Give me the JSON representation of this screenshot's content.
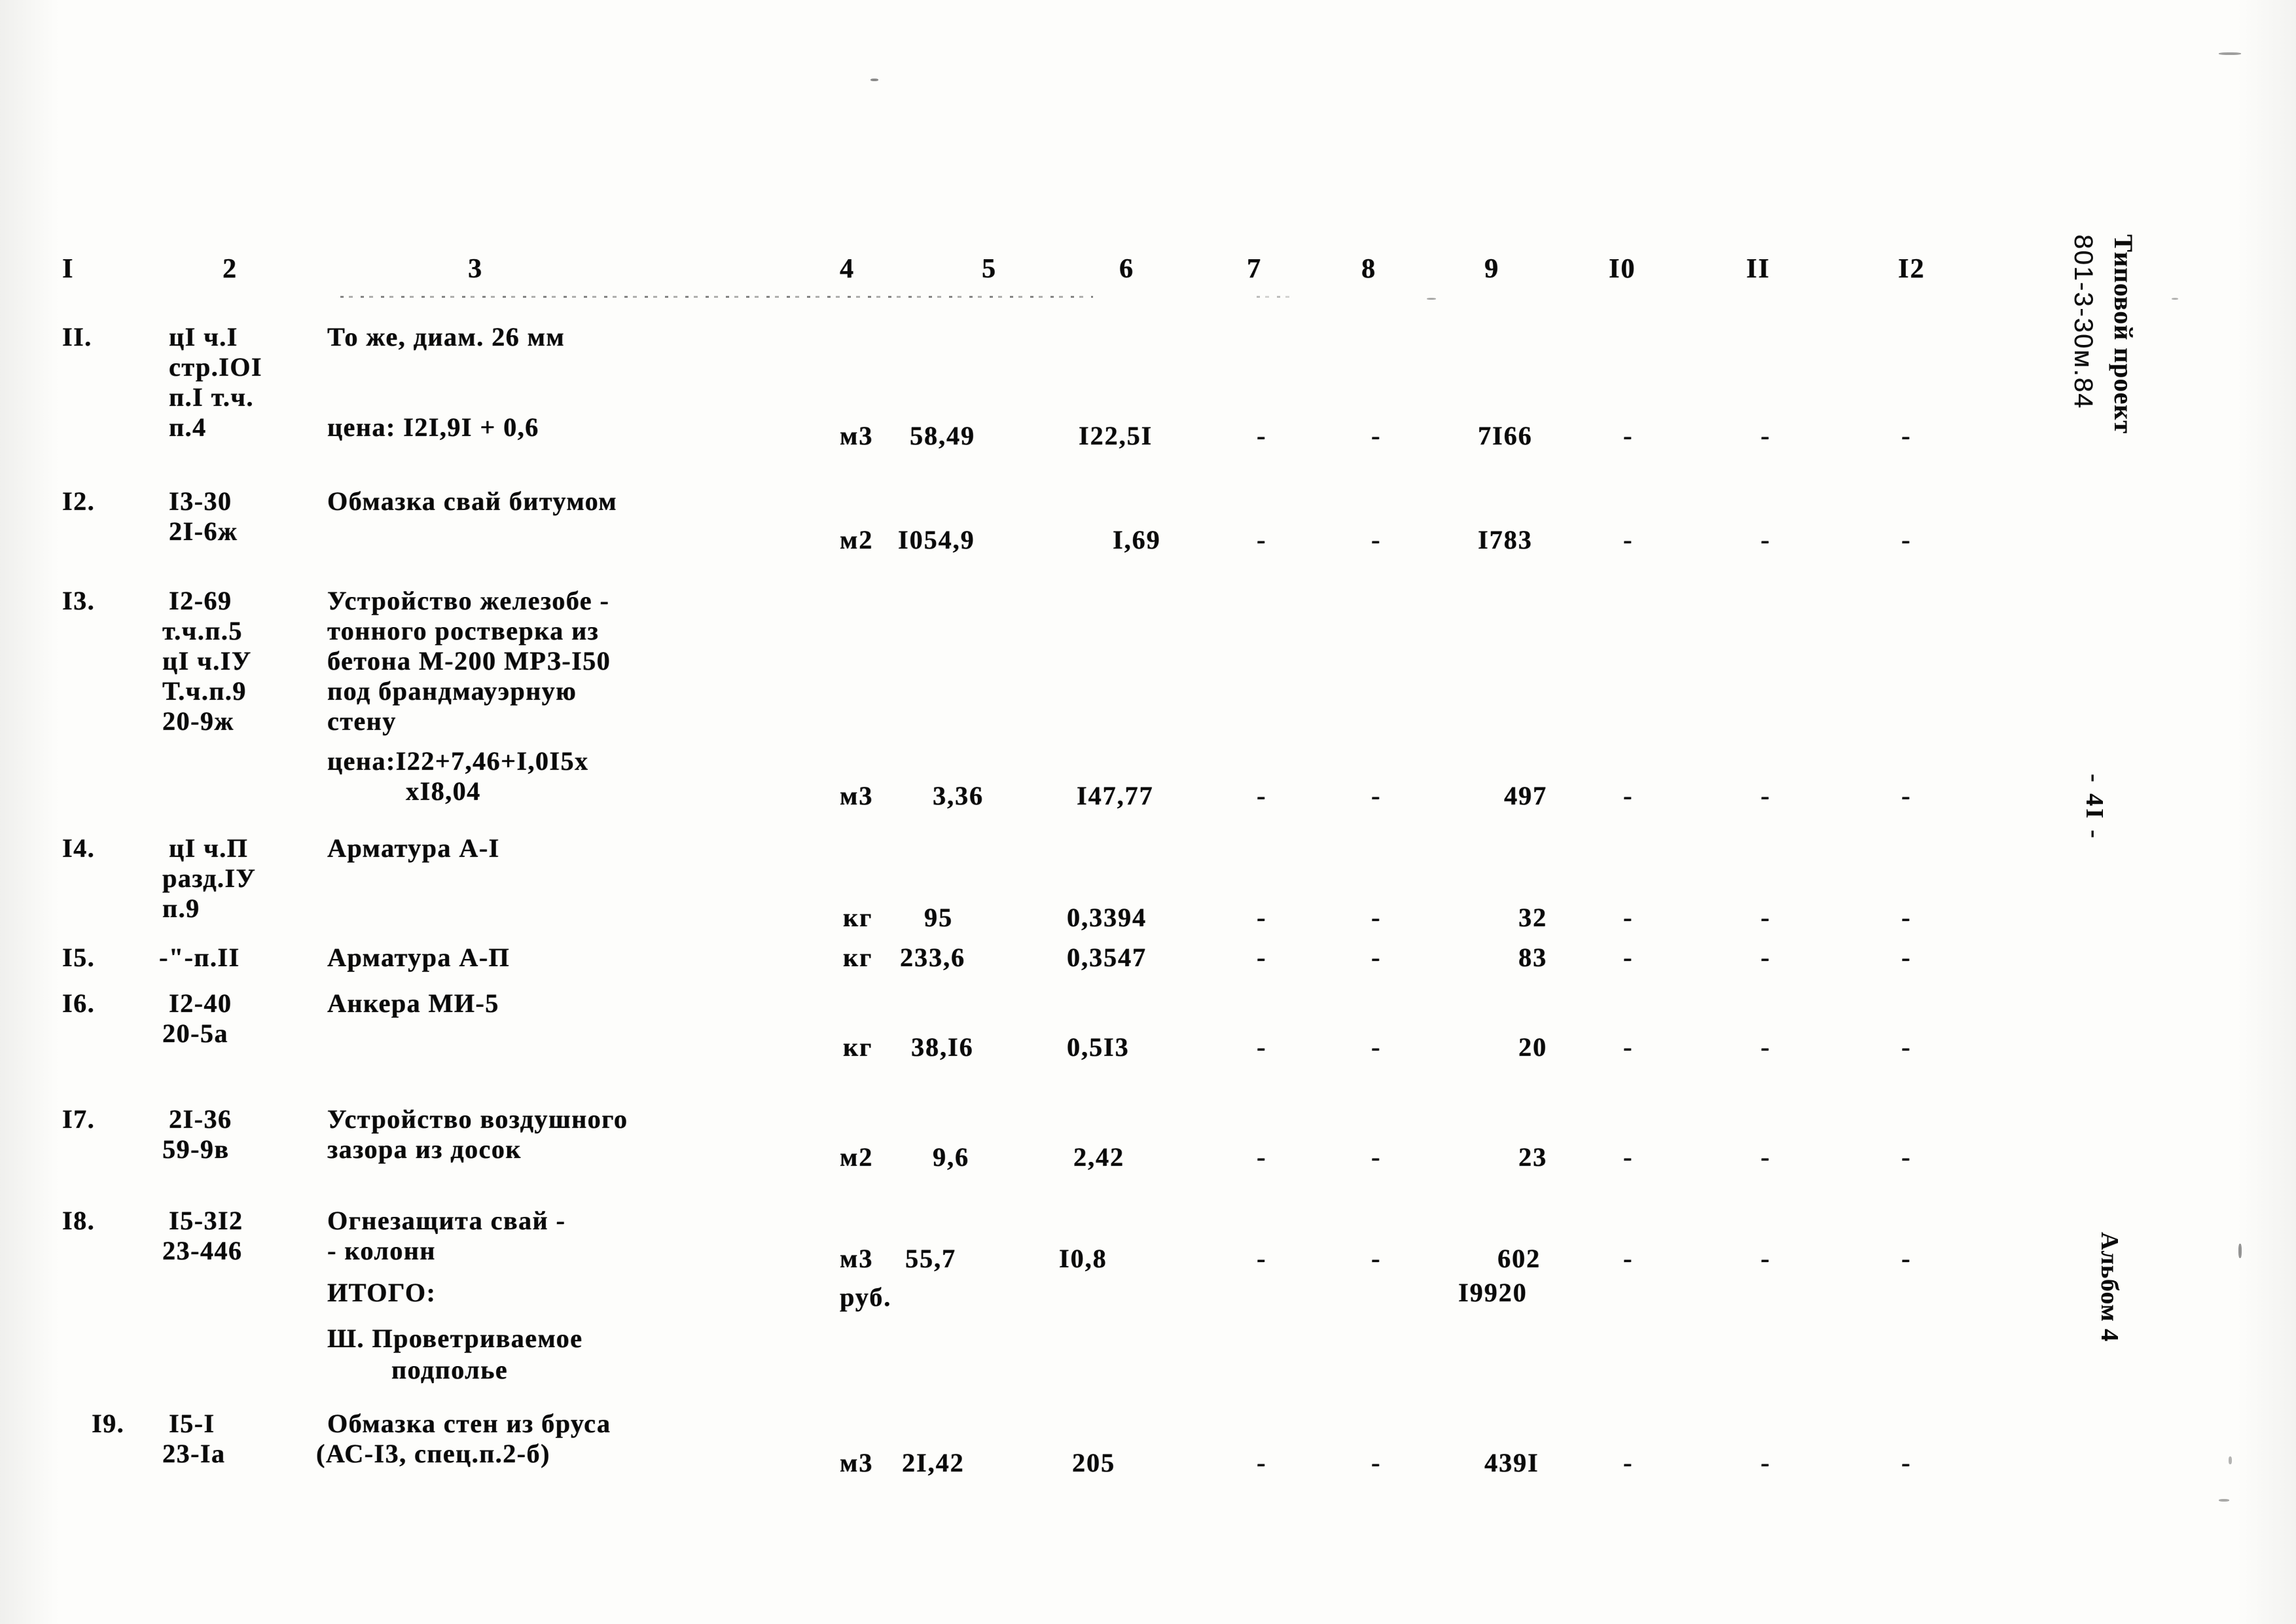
{
  "document": {
    "project_label": "Типовой проект",
    "project_code": "801-3-30м.84",
    "page_number": "- 4I -",
    "album": "Альбом 4"
  },
  "table": {
    "column_headers": [
      "I",
      "2",
      "3",
      "4",
      "5",
      "6",
      "7",
      "8",
      "9",
      "I0",
      "II",
      "I2"
    ],
    "rows": [
      {
        "no": "II.",
        "code_lines": [
          "цI ч.I",
          "стр.IOI",
          "п.I т.ч.",
          "п.4"
        ],
        "desc_lines": [
          "То же, диам. 26 мм",
          "",
          "",
          "цена: I2I,9I + 0,6"
        ],
        "unit": "м3",
        "qty": "58,49",
        "price": "I22,5I",
        "c7": "-",
        "c8": "-",
        "total": "7I66",
        "c10": "-",
        "c11": "-",
        "c12": "-"
      },
      {
        "no": "I2.",
        "code_lines": [
          "I3-30",
          "2I-6ж"
        ],
        "desc_lines": [
          "Обмазка свай битумом",
          ""
        ],
        "unit": "м2",
        "qty": "I054,9",
        "price": "I,69",
        "c7": "-",
        "c8": "-",
        "total": "I783",
        "c10": "-",
        "c11": "-",
        "c12": "-"
      },
      {
        "no": "I3.",
        "code_lines": [
          "I2-69",
          "т.ч.п.5",
          "цI ч.IУ",
          "Т.ч.п.9",
          "20-9ж"
        ],
        "desc_lines": [
          "Устройство железобе -",
          "тонного ростверка из",
          "бетона М-200 МРЗ-I50",
          "под брандмауэрную",
          "стену",
          "цена:I22+7,46+I,0I5х",
          "хI8,04"
        ],
        "unit": "м3",
        "qty": "3,36",
        "price": "I47,77",
        "c7": "-",
        "c8": "-",
        "total": "497",
        "c10": "-",
        "c11": "-",
        "c12": "-"
      },
      {
        "no": "I4.",
        "code_lines": [
          "цI ч.П",
          "разд.IУ",
          "п.9"
        ],
        "desc_lines": [
          "Арматура А-I"
        ],
        "unit": "кг",
        "qty": "95",
        "price": "0,3394",
        "c7": "-",
        "c8": "-",
        "total": "32",
        "c10": "-",
        "c11": "-",
        "c12": "-"
      },
      {
        "no": "I5.",
        "code_lines": [
          "-\"-п.II"
        ],
        "desc_lines": [
          "Арматура А-П"
        ],
        "unit": "кг",
        "qty": "233,6",
        "price": "0,3547",
        "c7": "-",
        "c8": "-",
        "total": "83",
        "c10": "-",
        "c11": "-",
        "c12": "-"
      },
      {
        "no": "I6.",
        "code_lines": [
          "I2-40",
          "20-5а"
        ],
        "desc_lines": [
          "Анкера МИ-5"
        ],
        "unit": "кг",
        "qty": "38,I6",
        "price": "0,5I3",
        "c7": "-",
        "c8": "-",
        "total": "20",
        "c10": "-",
        "c11": "-",
        "c12": "-"
      },
      {
        "no": "I7.",
        "code_lines": [
          "2I-36",
          "59-9в"
        ],
        "desc_lines": [
          "Устройство воздушного",
          "зазора из досок"
        ],
        "unit": "м2",
        "qty": "9,6",
        "price": "2,42",
        "c7": "-",
        "c8": "-",
        "total": "23",
        "c10": "-",
        "c11": "-",
        "c12": "-"
      },
      {
        "no": "I8.",
        "code_lines": [
          "I5-3I2",
          "23-446"
        ],
        "desc_lines": [
          "Огнезащита свай -",
          "- колонн"
        ],
        "unit": "м3",
        "qty": "55,7",
        "price": "I0,8",
        "c7": "-",
        "c8": "-",
        "total": "602",
        "c10": "-",
        "c11": "-",
        "c12": "-"
      },
      {
        "no": "I9.",
        "code_lines": [
          "I5-I",
          "23-Iа"
        ],
        "desc_lines": [
          "Обмазка стен из бруса",
          "(АС-I3, спец.п.2-б)"
        ],
        "unit": "м3",
        "qty": "2I,42",
        "price": "205",
        "c7": "-",
        "c8": "-",
        "total": "439I",
        "c10": "-",
        "c11": "-",
        "c12": "-"
      }
    ],
    "subtotal": {
      "label": "ИТОГО:",
      "unit": "руб.",
      "value": "I9920"
    },
    "section_heading": {
      "line1": "Ш. Проветриваемое",
      "line2": "подполье"
    }
  }
}
